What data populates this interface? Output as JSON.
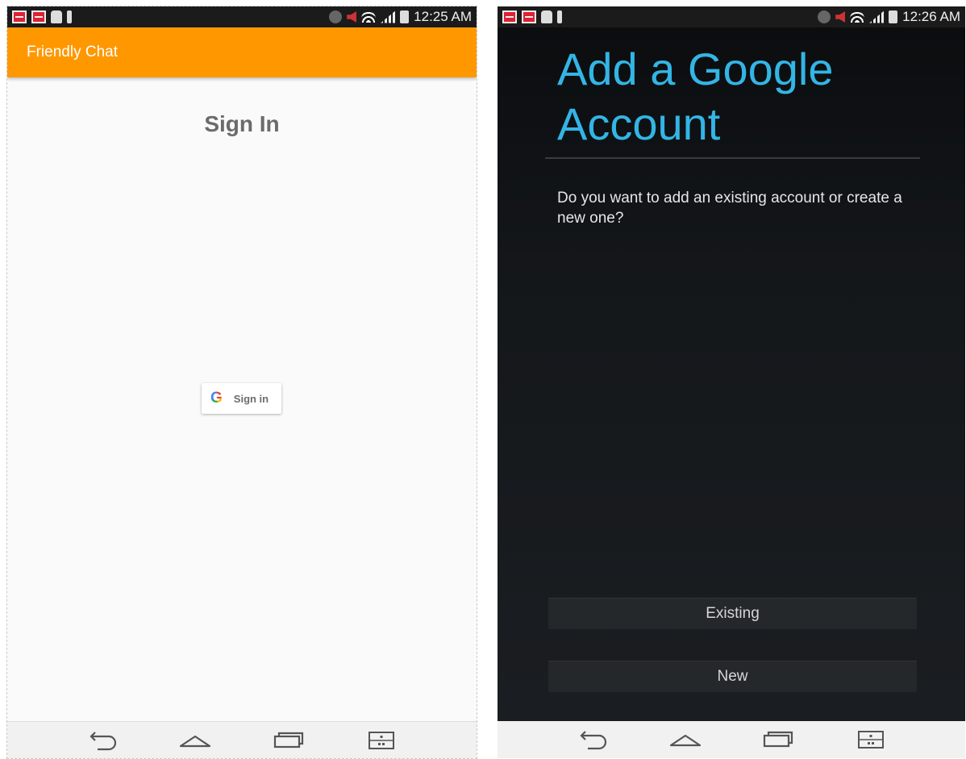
{
  "left_screen": {
    "status": {
      "time": "12:25 AM"
    },
    "appbar": {
      "title": "Friendly Chat"
    },
    "heading": "Sign In",
    "google_button": {
      "icon_letter": "G",
      "label": "Sign in"
    }
  },
  "right_screen": {
    "status": {
      "time": "12:26 AM"
    },
    "dialog": {
      "title": "Add a Google Account",
      "question": "Do you want to add an existing account or create a new one?",
      "existing_label": "Existing",
      "new_label": "New"
    }
  },
  "colors": {
    "appbar": "#ff9800",
    "dialog_title": "#33b5e5"
  },
  "icons": {
    "status_left": [
      "notification-icon",
      "notification-icon",
      "android-debug-icon",
      "usb-icon"
    ],
    "status_right": [
      "bluetooth-icon",
      "mute-icon",
      "wifi-icon",
      "signal-icon",
      "battery-icon"
    ],
    "navbar": [
      "back-icon",
      "home-icon",
      "recents-icon",
      "menu-icon"
    ]
  }
}
